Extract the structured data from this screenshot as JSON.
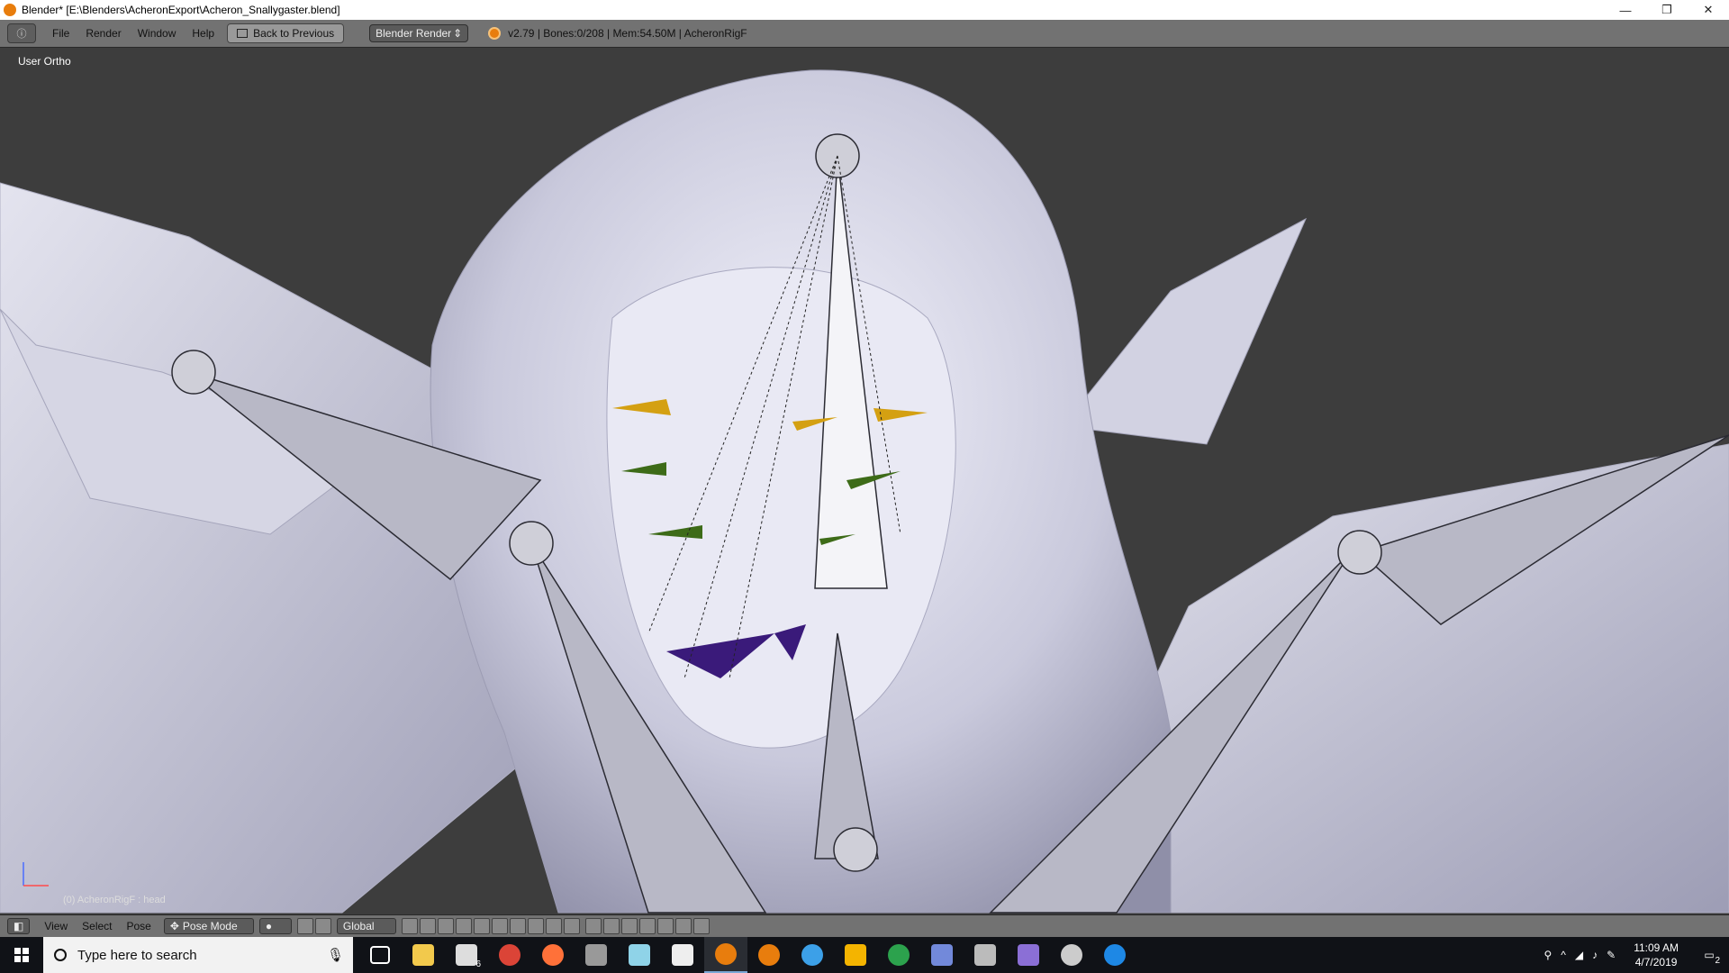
{
  "window": {
    "title": "Blender* [E:\\Blenders\\AcheronExport\\Acheron_Snallygaster.blend]",
    "controls": [
      "—",
      "❐",
      "✕"
    ]
  },
  "info_header": {
    "editor_icon": "ⓘ",
    "menus": [
      "File",
      "Render",
      "Window",
      "Help"
    ],
    "back_button": "Back to Previous",
    "render_engine": "Blender Render",
    "stats": "v2.79 | Bones:0/208 | Mem:54.50M | AcheronRigF"
  },
  "viewport": {
    "view_label": "User Ortho",
    "object_label": "(0) AcheronRigF : head"
  },
  "view3d_header": {
    "menus": [
      "View",
      "Select",
      "Pose"
    ],
    "mode": "Pose Mode",
    "orientation": "Global"
  },
  "taskbar": {
    "search_placeholder": "Type here to search",
    "time": "11:09 AM",
    "date": "4/7/2019",
    "mail_badge": "6",
    "notification_count": "2",
    "apps": [
      {
        "name": "task-view-icon",
        "color": "#ffffff"
      },
      {
        "name": "file-explorer-icon",
        "color": "#f2c94c"
      },
      {
        "name": "mail-icon",
        "color": "#dddddd"
      },
      {
        "name": "chrome-icon",
        "color": "#db4437"
      },
      {
        "name": "firefox-icon",
        "color": "#ff7139"
      },
      {
        "name": "game-icon",
        "color": "#999999"
      },
      {
        "name": "storage-icon",
        "color": "#8fd3e8"
      },
      {
        "name": "calculator-icon",
        "color": "#eeeeee"
      },
      {
        "name": "blender-icon",
        "color": "#e87d0d"
      },
      {
        "name": "blender-alt-icon",
        "color": "#e87d0d"
      },
      {
        "name": "word-app-icon",
        "color": "#3ca0e8"
      },
      {
        "name": "winamp-icon",
        "color": "#f4b400"
      },
      {
        "name": "xbox-icon",
        "color": "#2ca24d"
      },
      {
        "name": "discord-icon",
        "color": "#7289da"
      },
      {
        "name": "photos-icon",
        "color": "#bbbbbb"
      },
      {
        "name": "media-icon",
        "color": "#8b6fd6"
      },
      {
        "name": "steam-icon",
        "color": "#cccccc"
      },
      {
        "name": "edge-icon",
        "color": "#1e88e5"
      }
    ]
  }
}
